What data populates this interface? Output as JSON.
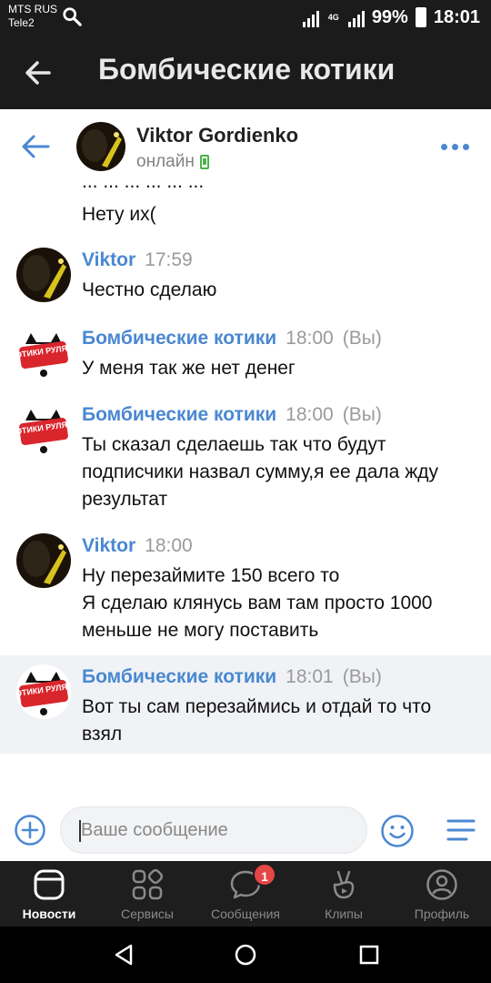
{
  "status_bar": {
    "carrier_1": "MTS RUS",
    "carrier_2": "Tele2",
    "network": "4G",
    "battery": "99%",
    "time": "18:01"
  },
  "top_bar": {
    "title": "Бомбические котики"
  },
  "chat_header": {
    "name": "Viktor Gordienko",
    "status": "онлайн"
  },
  "messages": {
    "partial_top_line": "... ... ... ... ... ...",
    "continued_text": "Нету их(",
    "items": [
      {
        "author": "Viktor",
        "time": "17:59",
        "you": "",
        "text": "Честно сделаю"
      },
      {
        "author": "Бомбические котики",
        "time": "18:00",
        "you": "(Вы)",
        "text": "У меня так же нет денег"
      },
      {
        "author": "Бомбические котики",
        "time": "18:00",
        "you": "(Вы)",
        "text": "Ты сказал сделаешь так что будут подписчики назвал сумму,я ее дала жду результат"
      },
      {
        "author": "Viktor",
        "time": "18:00",
        "you": "",
        "text": "Ну перезаймите 150 всего то\nЯ сделаю клянусь вам там просто 1000 меньше не могу поставить"
      },
      {
        "author": "Бомбические котики",
        "time": "18:01",
        "you": "(Вы)",
        "text": "Вот ты сам перезаймись и отдай то что взял"
      }
    ]
  },
  "composer": {
    "placeholder": "Ваше сообщение"
  },
  "tabs": [
    {
      "label": "Новости",
      "icon": "news-icon",
      "active": true
    },
    {
      "label": "Сервисы",
      "icon": "services-icon",
      "active": false
    },
    {
      "label": "Сообщения",
      "icon": "messages-icon",
      "active": false,
      "badge": "1"
    },
    {
      "label": "Клипы",
      "icon": "clips-icon",
      "active": false
    },
    {
      "label": "Профиль",
      "icon": "profile-icon",
      "active": false
    }
  ],
  "group_avatar_text": "КОТИКИ РУЛЯТ",
  "colors": {
    "accent": "#4a88d1",
    "dark_bar": "#1b1b1b",
    "badge": "#e64646",
    "online": "#4bb34b",
    "highlight_row": "#f0f2f5"
  }
}
